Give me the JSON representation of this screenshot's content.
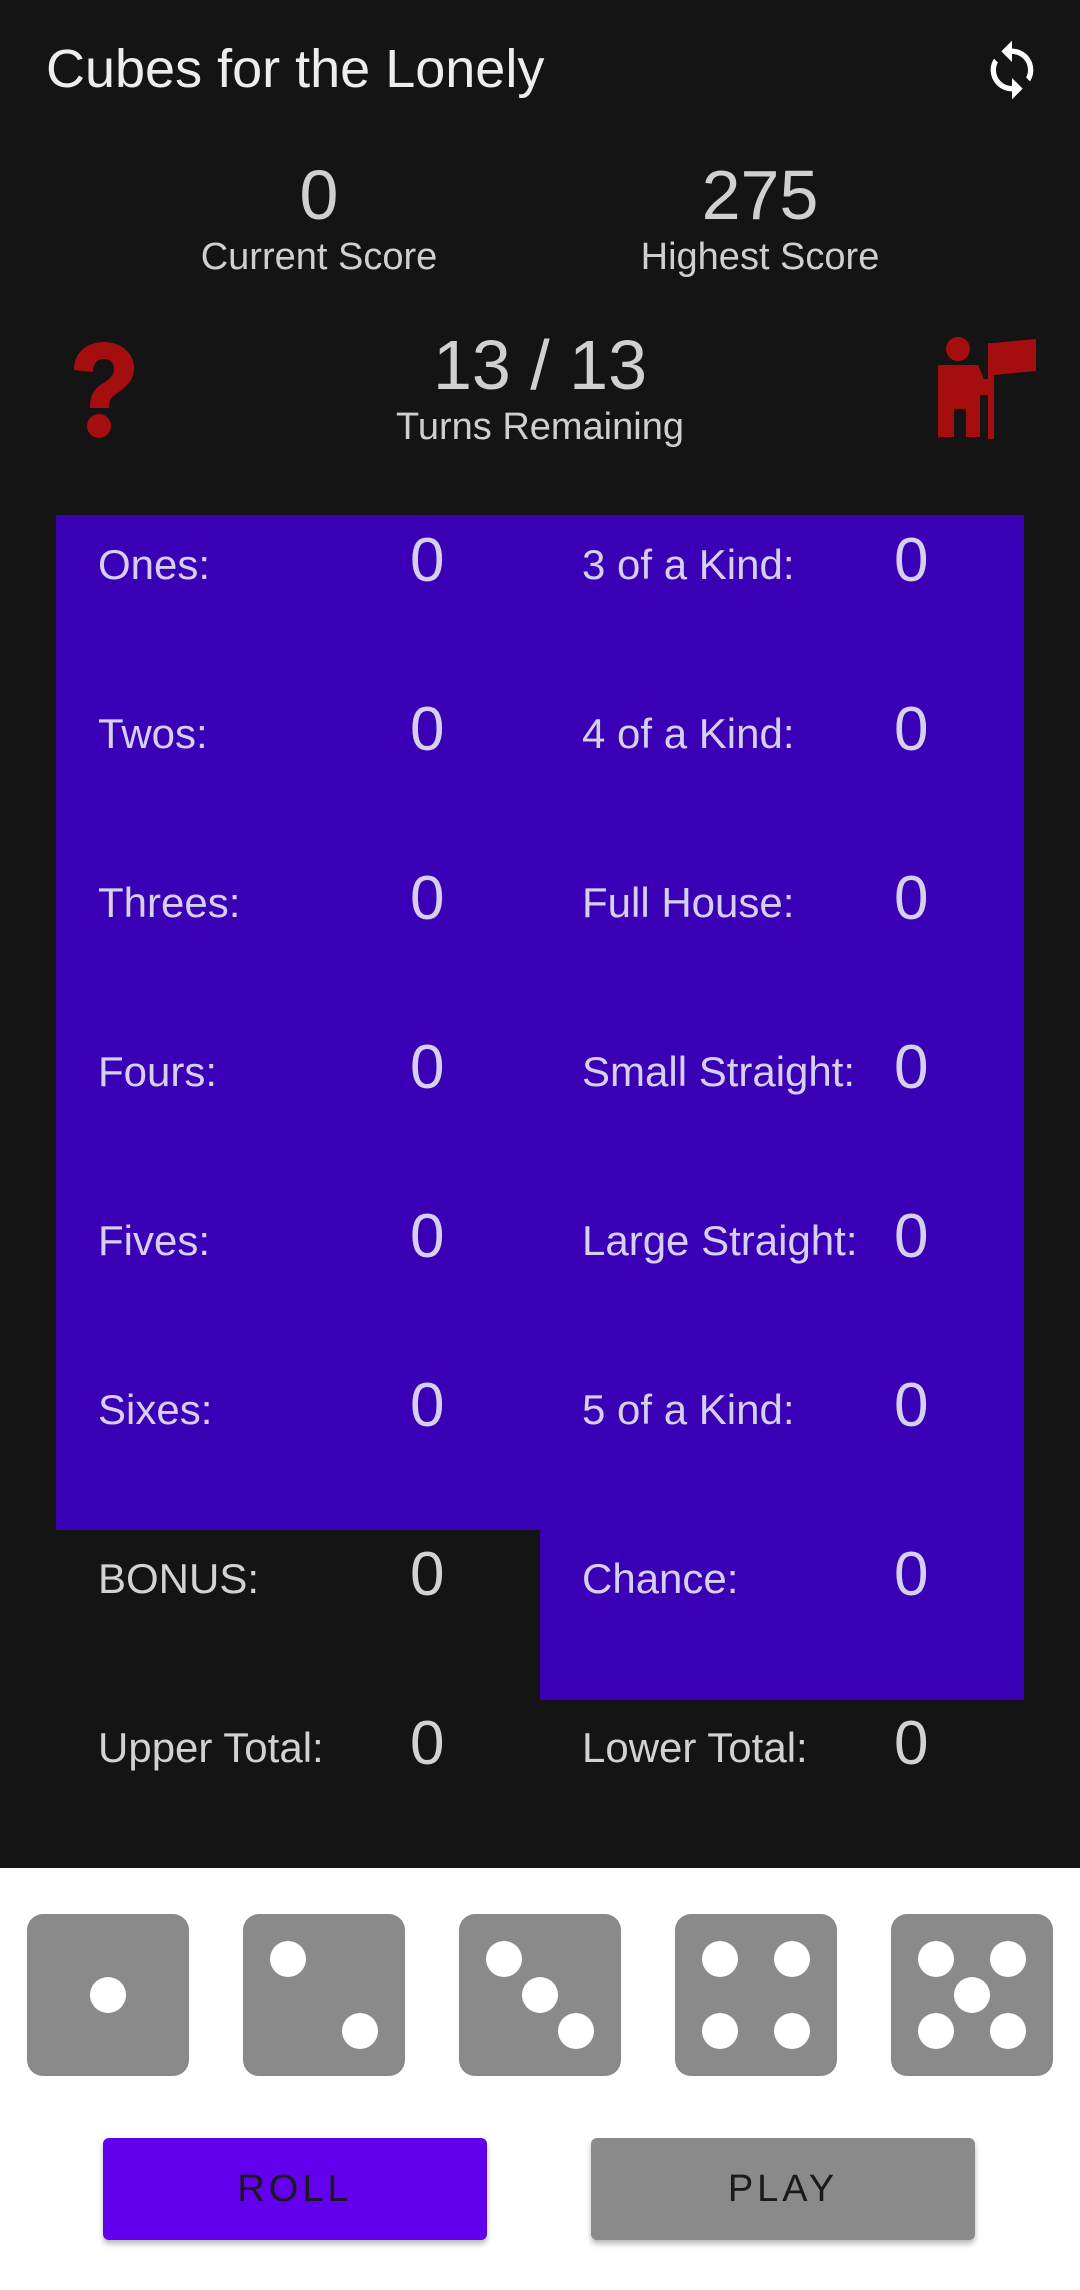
{
  "app": {
    "title": "Cubes for the Lonely"
  },
  "icons": {
    "refresh": "refresh-icon",
    "help": "question-mark-icon",
    "leaderboard": "person-flag-icon"
  },
  "scores": {
    "current": {
      "value": "0",
      "label": "Current Score"
    },
    "highest": {
      "value": "275",
      "label": "Highest Score"
    }
  },
  "turns": {
    "value": "13 / 13",
    "label": "Turns Remaining"
  },
  "upper": [
    {
      "label": "Ones:",
      "value": "0"
    },
    {
      "label": "Twos:",
      "value": "0"
    },
    {
      "label": "Threes:",
      "value": "0"
    },
    {
      "label": "Fours:",
      "value": "0"
    },
    {
      "label": "Fives:",
      "value": "0"
    },
    {
      "label": "Sixes:",
      "value": "0"
    }
  ],
  "lower": [
    {
      "label": "3 of a Kind:",
      "value": "0"
    },
    {
      "label": "4 of a Kind:",
      "value": "0"
    },
    {
      "label": "Full House:",
      "value": "0"
    },
    {
      "label": "Small Straight:",
      "value": "0"
    },
    {
      "label": "Large Straight:",
      "value": "0"
    },
    {
      "label": "5 of a Kind:",
      "value": "0"
    },
    {
      "label": "Chance:",
      "value": "0"
    }
  ],
  "bonus": {
    "label": "BONUS:",
    "value": "0"
  },
  "upper_total": {
    "label": "Upper Total:",
    "value": "0"
  },
  "lower_total": {
    "label": "Lower Total:",
    "value": "0"
  },
  "dice": [
    1,
    2,
    3,
    4,
    5
  ],
  "buttons": {
    "roll": "ROLL",
    "play": "PLAY"
  },
  "colors": {
    "background": "#141414",
    "scorecard": "#3a00b5",
    "roll_button": "#6200ee",
    "play_button": "#8a8a8a",
    "die": "#8a8a8a",
    "icon_red": "#a50e0e"
  }
}
